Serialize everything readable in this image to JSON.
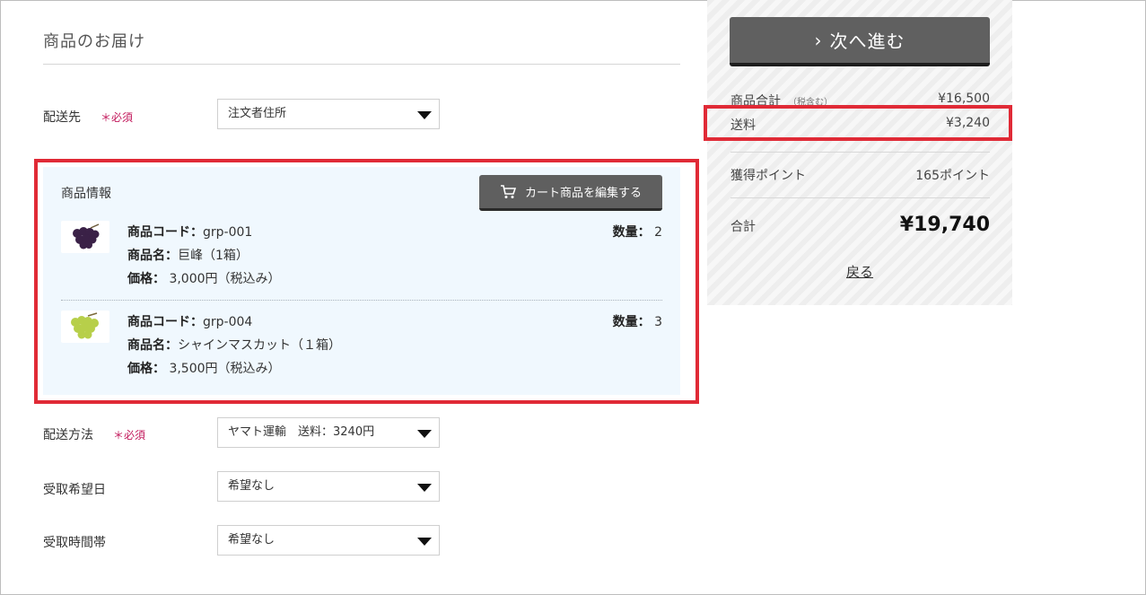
{
  "delivery": {
    "title": "商品のお届け",
    "destination_label": "配送先",
    "required_mark": "＊必須",
    "destination_value": "注文者住所",
    "method_label": "配送方法",
    "method_value": "ヤマト運輸　送料：3240円",
    "date_label": "受取希望日",
    "date_value": "希望なし",
    "time_label": "受取時間帯",
    "time_value": "希望なし"
  },
  "product_panel": {
    "title": "商品情報",
    "edit_button": "カート商品を編集する",
    "code_label": "商品コード：",
    "name_label": "商品名：",
    "price_label": "価格：",
    "qty_label": "数量：",
    "items": [
      {
        "code": "grp-001",
        "name": "巨峰（1箱）",
        "price": "3,000円（税込み）",
        "qty": "2",
        "thumb_color": "#3a2147"
      },
      {
        "code": "grp-004",
        "name": "シャインマスカット（１箱）",
        "price": "3,500円（税込み）",
        "qty": "3",
        "thumb_color": "#b7cf4a"
      }
    ]
  },
  "summary": {
    "next_button": "次へ進む",
    "subtotal_label": "商品合計",
    "subtotal_note": "（税含む）",
    "subtotal_value": "¥16,500",
    "shipping_label": "送料",
    "shipping_value": "¥3,240",
    "points_label": "獲得ポイント",
    "points_value": "165ポイント",
    "total_label": "合計",
    "total_value": "¥19,740",
    "back_link": "戻る"
  },
  "colors": {
    "highlight": "#e02a36",
    "required": "#c2185b",
    "button": "#606060",
    "panel_bg": "#f0f8fe"
  }
}
